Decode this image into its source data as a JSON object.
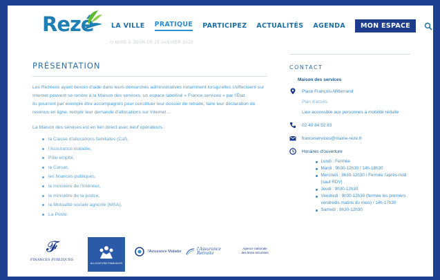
{
  "header": {
    "logo_text": "Rezé",
    "nav": [
      {
        "label": "LA VILLE"
      },
      {
        "label": "PRATIQUE"
      },
      {
        "label": "PARTICIPEZ"
      },
      {
        "label": "ACTUALITÉS"
      },
      {
        "label": "AGENDA"
      }
    ],
    "cta_label": "MON ESPACE",
    "update_text": "MISE À JOUR LE 25 JANVIER 2023"
  },
  "main": {
    "title": "PRÉSENTATION",
    "intro_1": "Les Rezéens ayant besoin d'aide dans leurs démarches administratives notamment lorsqu'elles s'effectuent sur Internet peuvent se rendre à la Maison des services, un espace labellisé « France services » par l'État.",
    "intro_2": "Ils pourront par exemple être accompagnés pour constituer leur dossier de retraite, faire leur déclaration de revenus en ligne, remplir leur demande d'allocations sur Internet…",
    "operators_intro": "La Maison des services est en lien direct avec neuf opérateurs :",
    "operators": [
      "la Caisse d'allocations familiales (Caf),",
      "l'Assurance maladie,",
      "Pôle emploi,",
      "la Carsat,",
      "les finances publiques,",
      "le ministère de l'Intérieur,",
      "le ministère de la justice,",
      "la Mutualité sociale agricole (MSA),",
      "La Poste."
    ]
  },
  "partners": {
    "finances": "FINANCES PUBLIQUES",
    "caf": "ALLOCATIONS FAMILIALES",
    "assurance_maladie": "l'Assurance Maladie",
    "assurance_retraite": "l'Assurance Retraite",
    "ants": "Agence nationale\ndes titres sécurisés"
  },
  "contact": {
    "title": "CONTACT",
    "org": "Maison des services",
    "address": "Place François-Mitterrand",
    "map_link": "Plan d'accès",
    "accessibility": "Lieu accessible aux personnes à mobilité réduite",
    "phone": "02 40 84 52 83",
    "email": "franceservices@mairie-reze.fr",
    "hours_label": "Horaires d'ouverture",
    "hours": [
      "Lundi : Fermée",
      "Mardi : 9h30-12h30 / 14h-18h30",
      "Mercredi : 9h30-12h30 / Fermée l'après-midi (sauf RDV)",
      "Jeudi : 9h30-12h30",
      "Vendredi : 9h30-12h30 (fermée les premiers vendredis matins du mois) / 14h-17h30",
      "Samedi : 9h30-12h30"
    ]
  },
  "colors": {
    "brand_blue": "#1e3c8c",
    "link_blue": "#3d8fd0",
    "logo_green": "#5fb833"
  }
}
